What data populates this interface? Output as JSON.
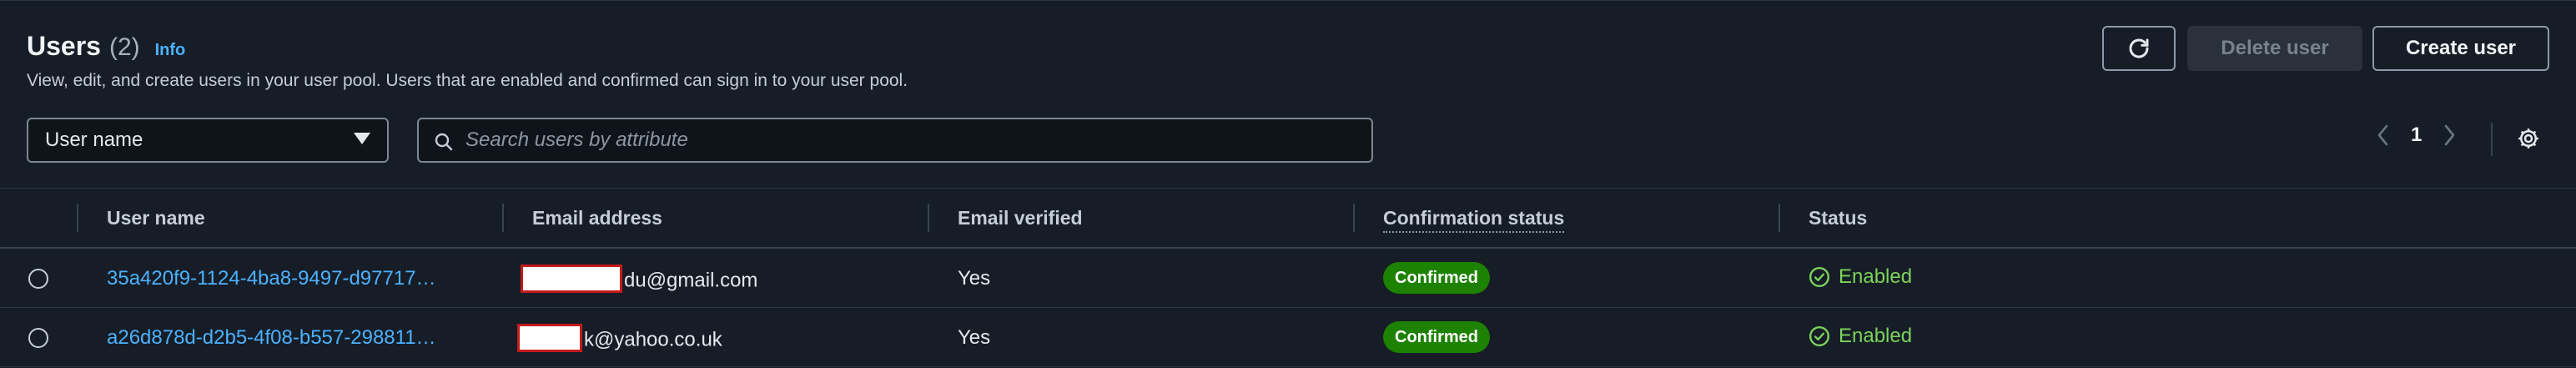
{
  "header": {
    "title": "Users",
    "count": "(2)",
    "info_label": "Info",
    "subtitle": "View, edit, and create users in your user pool. Users that are enabled and confirmed can sign in to your user pool."
  },
  "actions": {
    "refresh_icon": "refresh-icon",
    "delete_label": "Delete user",
    "create_label": "Create user"
  },
  "filters": {
    "property_selected": "User name",
    "search_placeholder": "Search users by attribute"
  },
  "pagination": {
    "current_page": "1"
  },
  "table": {
    "columns": [
      "User name",
      "Email address",
      "Email verified",
      "Confirmation status",
      "Status"
    ],
    "rows": [
      {
        "username": "35a420f9-1124-4ba8-9497-d97717…",
        "email_visible": "du@gmail.com",
        "email_verified": "Yes",
        "confirmation_status": "Confirmed",
        "status": "Enabled"
      },
      {
        "username": "a26d878d-d2b5-4f08-b557-298811…",
        "email_visible": "k@yahoo.co.uk",
        "email_verified": "Yes",
        "confirmation_status": "Confirmed",
        "status": "Enabled"
      }
    ]
  },
  "colors": {
    "background": "#161d26",
    "link": "#4cb1ff",
    "badge_green": "#1d8102",
    "status_green": "#7bd35c",
    "redaction_border": "#c41b1b"
  }
}
